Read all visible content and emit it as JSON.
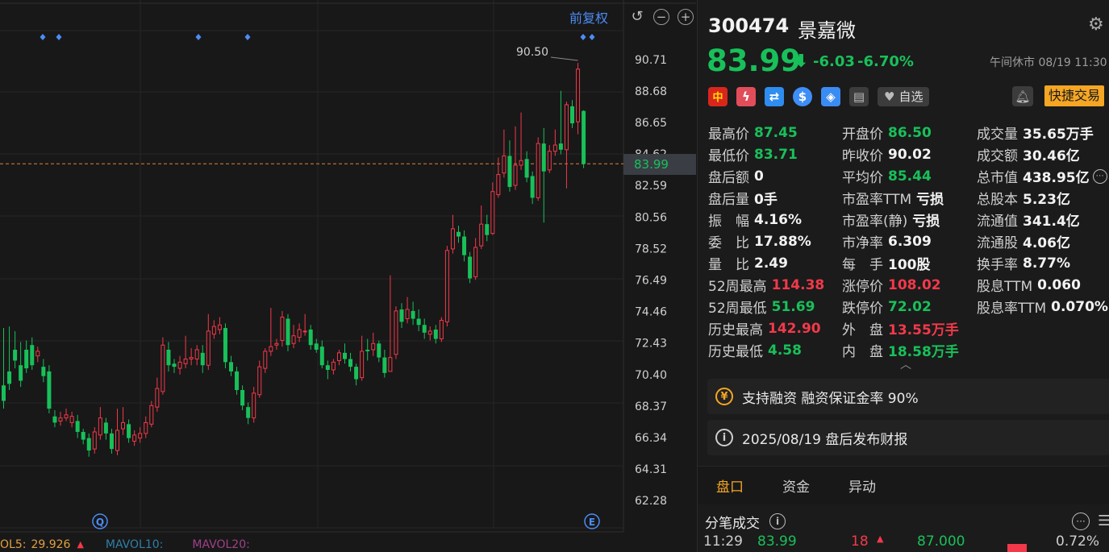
{
  "chart": {
    "adjust_label": "前复权",
    "current_price_tag": "83.99",
    "high_label": "90.50",
    "y_ticks": [
      "90.71",
      "88.68",
      "86.65",
      "84.62",
      "82.59",
      "80.56",
      "78.52",
      "76.49",
      "74.46",
      "72.43",
      "70.40",
      "68.37",
      "66.34",
      "64.31",
      "62.28"
    ],
    "q_marker": "Q",
    "e_marker": "E",
    "vol_legend": {
      "vol5_label": "OL5:",
      "vol5_value": "29.926",
      "vol10_label": "MAVOL10:",
      "vol20_label": "MAVOL20:"
    },
    "colors": {
      "up": "#f2394a",
      "down": "#18c05a",
      "grid": "#262626",
      "price_line": "#e0803a"
    }
  },
  "chart_data": {
    "type": "candlestick",
    "y_range": [
      61.5,
      91.5
    ],
    "last_price": 83.99,
    "high_mark": 90.5,
    "candles": [
      [
        69.7,
        68.7,
        73.4,
        68.2
      ],
      [
        70.6,
        69.8,
        73.5,
        69.4
      ],
      [
        72.0,
        71.3,
        73.2,
        70.8
      ],
      [
        71.0,
        70.0,
        72.5,
        69.6
      ],
      [
        72.0,
        70.8,
        72.6,
        70.5
      ],
      [
        72.3,
        71.0,
        72.8,
        70.7
      ],
      [
        71.6,
        71.9,
        72.2,
        71.2
      ],
      [
        70.9,
        70.3,
        71.4,
        69.9
      ],
      [
        70.6,
        68.2,
        71.0,
        67.9
      ],
      [
        67.7,
        67.3,
        68.1,
        67.0
      ],
      [
        67.4,
        67.6,
        68.0,
        67.1
      ],
      [
        67.6,
        67.8,
        68.2,
        67.4
      ],
      [
        67.3,
        67.7,
        68.0,
        67.0
      ],
      [
        67.4,
        66.7,
        67.8,
        66.3
      ],
      [
        66.7,
        66.2,
        66.9,
        65.9
      ],
      [
        66.3,
        65.5,
        66.6,
        65.1
      ],
      [
        65.6,
        66.7,
        67.0,
        65.3
      ],
      [
        66.5,
        67.6,
        68.3,
        66.2
      ],
      [
        67.3,
        66.6,
        67.6,
        66.2
      ],
      [
        66.6,
        65.6,
        66.9,
        65.3
      ],
      [
        65.5,
        66.8,
        68.2,
        65.2
      ],
      [
        66.9,
        67.3,
        68.3,
        66.5
      ],
      [
        67.2,
        66.3,
        67.5,
        66.0
      ],
      [
        66.1,
        66.5,
        66.8,
        65.8
      ],
      [
        66.3,
        66.6,
        67.0,
        66.0
      ],
      [
        66.6,
        67.3,
        67.7,
        66.3
      ],
      [
        67.2,
        68.4,
        68.7,
        67.0
      ],
      [
        68.3,
        69.5,
        70.2,
        68.0
      ],
      [
        69.3,
        72.3,
        72.8,
        69.1
      ],
      [
        72.0,
        71.0,
        72.5,
        70.6
      ],
      [
        71.1,
        70.9,
        71.4,
        70.5
      ],
      [
        70.8,
        71.2,
        71.6,
        70.4
      ],
      [
        71.1,
        71.4,
        72.9,
        70.8
      ],
      [
        71.4,
        71.5,
        72.1,
        71.0
      ],
      [
        71.4,
        72.0,
        72.3,
        71.0
      ],
      [
        71.8,
        71.0,
        72.3,
        70.5
      ],
      [
        71.0,
        73.2,
        74.3,
        70.7
      ],
      [
        73.0,
        73.5,
        73.9,
        72.7
      ],
      [
        73.3,
        73.6,
        74.1,
        73.0
      ],
      [
        73.4,
        71.2,
        73.7,
        70.8
      ],
      [
        71.2,
        70.6,
        71.6,
        70.3
      ],
      [
        70.6,
        69.4,
        70.9,
        69.1
      ],
      [
        69.4,
        68.4,
        69.7,
        68.1
      ],
      [
        68.3,
        67.6,
        68.6,
        67.2
      ],
      [
        67.6,
        69.2,
        69.6,
        67.3
      ],
      [
        69.1,
        70.9,
        71.3,
        68.9
      ],
      [
        70.8,
        71.9,
        72.1,
        70.5
      ],
      [
        71.9,
        72.2,
        74.7,
        71.6
      ],
      [
        72.3,
        72.4,
        72.7,
        72.0
      ],
      [
        72.6,
        74.1,
        74.5,
        72.2
      ],
      [
        74.0,
        72.3,
        74.3,
        71.9
      ],
      [
        72.4,
        72.9,
        73.6,
        72.1
      ],
      [
        72.8,
        73.3,
        73.7,
        72.5
      ],
      [
        73.2,
        73.2,
        74.3,
        72.9
      ],
      [
        73.3,
        72.3,
        73.6,
        72.0
      ],
      [
        72.4,
        72.0,
        72.7,
        71.8
      ],
      [
        72.2,
        71.0,
        72.6,
        70.8
      ],
      [
        71.0,
        70.7,
        71.3,
        70.1
      ],
      [
        70.7,
        71.2,
        71.4,
        70.4
      ],
      [
        71.3,
        71.8,
        72.0,
        71.0
      ],
      [
        71.8,
        71.4,
        72.4,
        71.1
      ],
      [
        71.4,
        70.9,
        71.8,
        70.6
      ],
      [
        70.9,
        70.1,
        71.1,
        69.7
      ],
      [
        70.2,
        71.9,
        72.9,
        70.0
      ],
      [
        72.0,
        71.9,
        72.7,
        71.3
      ],
      [
        72.0,
        72.4,
        73.1,
        71.6
      ],
      [
        72.4,
        71.5,
        72.6,
        71.2
      ],
      [
        71.5,
        70.5,
        72.0,
        70.2
      ],
      [
        70.6,
        71.5,
        76.8,
        70.6
      ],
      [
        71.7,
        74.5,
        74.8,
        71.4
      ],
      [
        74.6,
        73.8,
        75.0,
        73.4
      ],
      [
        74.0,
        74.6,
        75.4,
        73.7
      ],
      [
        74.5,
        74.0,
        75.1,
        73.6
      ],
      [
        74.0,
        73.6,
        74.6,
        73.2
      ],
      [
        73.6,
        73.1,
        74.0,
        72.7
      ],
      [
        73.0,
        73.2,
        73.5,
        72.6
      ],
      [
        73.3,
        72.7,
        73.6,
        72.4
      ],
      [
        72.7,
        73.9,
        74.1,
        72.5
      ],
      [
        73.8,
        78.4,
        78.7,
        73.5
      ],
      [
        78.5,
        79.8,
        80.7,
        78.2
      ],
      [
        79.6,
        79.3,
        80.0,
        78.9
      ],
      [
        79.3,
        78.1,
        79.7,
        77.7
      ],
      [
        78.0,
        76.6,
        78.3,
        76.3
      ],
      [
        76.7,
        78.6,
        79.2,
        76.5
      ],
      [
        78.7,
        80.1,
        81.3,
        78.5
      ],
      [
        80.1,
        79.4,
        80.7,
        79.0
      ],
      [
        79.5,
        82.2,
        82.8,
        79.4
      ],
      [
        82.0,
        83.3,
        84.4,
        81.8
      ],
      [
        83.4,
        84.5,
        86.2,
        83.1
      ],
      [
        84.5,
        82.5,
        85.5,
        82.2
      ],
      [
        82.6,
        83.9,
        86.4,
        82.3
      ],
      [
        83.9,
        84.2,
        87.3,
        83.6
      ],
      [
        84.3,
        83.1,
        84.8,
        82.8
      ],
      [
        83.2,
        81.8,
        83.5,
        81.4
      ],
      [
        81.8,
        85.3,
        85.7,
        81.6
      ],
      [
        85.3,
        83.5,
        86.3,
        80.2
      ],
      [
        83.6,
        84.8,
        85.2,
        83.4
      ],
      [
        84.8,
        85.2,
        86.2,
        84.5
      ],
      [
        85.3,
        84.9,
        88.7,
        84.6
      ],
      [
        84.9,
        87.8,
        88.0,
        82.4
      ],
      [
        87.7,
        86.6,
        88.1,
        86.3
      ],
      [
        86.7,
        90.1,
        90.5,
        85.9
      ],
      [
        87.4,
        83.99,
        87.45,
        83.71
      ]
    ]
  },
  "stock": {
    "code": "300474",
    "name": "景嘉微",
    "price": "83.99",
    "change_abs": "-6.03",
    "change_pct": "-6.70%",
    "status": "午间休市 08/19 11:30"
  },
  "badges": {
    "cn": "中",
    "flash": "ϟ",
    "swap": "⇄",
    "dollar": "$",
    "tag": "◈",
    "doc": "▤",
    "watch_label": "自选",
    "trade_label": "快捷交易"
  },
  "stats": [
    {
      "label": "最高价",
      "value": "87.45",
      "color": "green"
    },
    {
      "label": "开盘价",
      "value": "86.50",
      "color": "green"
    },
    {
      "label": "成交量",
      "value": "35.65万手",
      "color": "white"
    },
    {
      "label": "最低价",
      "value": "83.71",
      "color": "green"
    },
    {
      "label": "昨收价",
      "value": "90.02",
      "color": "white"
    },
    {
      "label": "成交额",
      "value": "30.46亿",
      "color": "white"
    },
    {
      "label": "盘后额",
      "value": "0",
      "color": "white"
    },
    {
      "label": "平均价",
      "value": "85.44",
      "color": "green"
    },
    {
      "label": "总市值",
      "value": "438.95亿",
      "color": "white"
    },
    {
      "label": "盘后量",
      "value": "0手",
      "color": "white"
    },
    {
      "label": "市盈率TTM",
      "value": "亏损",
      "color": "white"
    },
    {
      "label": "总股本",
      "value": "5.23亿",
      "color": "white"
    },
    {
      "label": "振　幅",
      "value": "4.16%",
      "color": "white"
    },
    {
      "label": "市盈率(静)",
      "value": "亏损",
      "color": "white"
    },
    {
      "label": "流通值",
      "value": "341.4亿",
      "color": "white"
    },
    {
      "label": "委　比",
      "value": "17.88%",
      "color": "white"
    },
    {
      "label": "市净率",
      "value": "6.309",
      "color": "white"
    },
    {
      "label": "流通股",
      "value": "4.06亿",
      "color": "white"
    },
    {
      "label": "量　比",
      "value": "2.49",
      "color": "white"
    },
    {
      "label": "每　手",
      "value": "100股",
      "color": "white"
    },
    {
      "label": "换手率",
      "value": "8.77%",
      "color": "white"
    },
    {
      "label": "52周最高",
      "value": "114.38",
      "color": "red"
    },
    {
      "label": "涨停价",
      "value": "108.02",
      "color": "red"
    },
    {
      "label": "股息TTM",
      "value": "0.060",
      "color": "white"
    },
    {
      "label": "52周最低",
      "value": "51.69",
      "color": "green"
    },
    {
      "label": "跌停价",
      "value": "72.02",
      "color": "green"
    },
    {
      "label": "股息率TTM",
      "value": "0.070%",
      "color": "white"
    },
    {
      "label": "历史最高",
      "value": "142.90",
      "color": "red"
    },
    {
      "label": "外　盘",
      "value": "13.55万手",
      "color": "red"
    },
    {
      "label": "",
      "value": "",
      "color": "white"
    },
    {
      "label": "历史最低",
      "value": "4.58",
      "color": "green"
    },
    {
      "label": "内　盘",
      "value": "18.58万手",
      "color": "green"
    },
    {
      "label": "",
      "value": "",
      "color": "white"
    }
  ],
  "notices": {
    "margin_icon": "¥",
    "margin_text": "支持融资 融资保证金率 90%",
    "report_icon": "i",
    "report_text": "2025/08/19  盘后发布财报"
  },
  "tabs": [
    {
      "label": "盘口"
    },
    {
      "label": "资金"
    },
    {
      "label": "异动"
    }
  ],
  "trades": {
    "title": "分笔成交",
    "info_icon": "i",
    "row_time": "11:29",
    "row_price": "83.99",
    "row_vol": "18",
    "row_other": "87.000",
    "row_pct": "0.72%"
  }
}
